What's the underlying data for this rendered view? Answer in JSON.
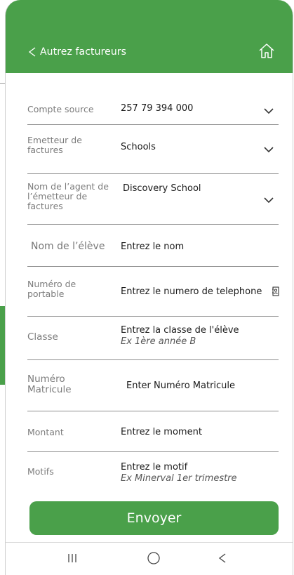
{
  "header": {
    "back_label": "Autrez factureurs",
    "back_icon": "chevron-left-icon",
    "home_icon": "home-icon",
    "color": "#4aa04a"
  },
  "form": {
    "source_account": {
      "label": "Compte source",
      "value": "257 79 394 000"
    },
    "biller": {
      "label": "Emetteur de factures",
      "value": "Schools"
    },
    "biller_agent": {
      "label": "Nom de l’agent de l’émetteur de factures",
      "value": "Discovery School"
    },
    "student_name": {
      "label": "Nom de l’élève",
      "placeholder": "Entrez le nom"
    },
    "phone": {
      "label": "Numéro de portable",
      "placeholder": "Entrez le numero de telephone"
    },
    "class": {
      "label": "Classe",
      "placeholder": "Entrez la classe de l'élève",
      "hint": "Ex 1ère année B"
    },
    "matricule": {
      "label": "Numéro Matricule",
      "placeholder": "Enter Numéro Matricule"
    },
    "amount": {
      "label": "Montant",
      "placeholder": "Entrez le moment"
    },
    "motif": {
      "label": "Motifs",
      "placeholder": "Entrez le motif",
      "hint": "Ex Minerval 1er trimestre"
    }
  },
  "submit_label": "Envoyer",
  "navbar": {
    "icons": [
      "recent-apps-icon",
      "home-circle-icon",
      "back-icon"
    ]
  }
}
